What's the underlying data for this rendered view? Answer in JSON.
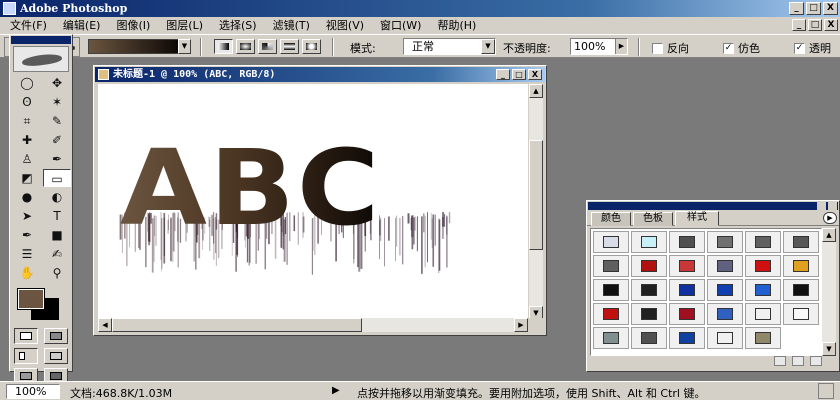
{
  "app": {
    "title": "Adobe Photoshop"
  },
  "window_controls": {
    "minimize": "_",
    "maximize": "□",
    "close": "X"
  },
  "menu": {
    "items": [
      "文件(F)",
      "编辑(E)",
      "图像(I)",
      "图层(L)",
      "选择(S)",
      "滤镜(T)",
      "视图(V)",
      "窗口(W)",
      "帮助(H)"
    ]
  },
  "options": {
    "mode_label": "模式:",
    "mode_value": "正常",
    "opacity_label": "不透明度:",
    "opacity_value": "100%",
    "reverse_label": "反向",
    "reverse_checked": false,
    "dither_label": "仿色",
    "dither_checked": true,
    "transparency_label": "透明",
    "transparency_checked": true,
    "gradient_colors": [
      "#6b5540",
      "#0d0805"
    ]
  },
  "toolbox": {
    "tools": [
      {
        "name": "marquee-tool",
        "glyph": "◯"
      },
      {
        "name": "move-tool",
        "glyph": "✥"
      },
      {
        "name": "lasso-tool",
        "glyph": "ʘ"
      },
      {
        "name": "magic-wand-tool",
        "glyph": "✶"
      },
      {
        "name": "crop-tool",
        "glyph": "⌗"
      },
      {
        "name": "slice-tool",
        "glyph": "✎"
      },
      {
        "name": "healing-brush-tool",
        "glyph": "✚"
      },
      {
        "name": "brush-tool",
        "glyph": "✐"
      },
      {
        "name": "clone-stamp-tool",
        "glyph": "♙"
      },
      {
        "name": "history-brush-tool",
        "glyph": "✒"
      },
      {
        "name": "eraser-tool",
        "glyph": "◩"
      },
      {
        "name": "gradient-tool",
        "glyph": "▭"
      },
      {
        "name": "blur-tool",
        "glyph": "●"
      },
      {
        "name": "dodge-tool",
        "glyph": "◐"
      },
      {
        "name": "path-selection-tool",
        "glyph": "➤"
      },
      {
        "name": "type-tool",
        "glyph": "T"
      },
      {
        "name": "pen-tool",
        "glyph": "✒"
      },
      {
        "name": "shape-tool",
        "glyph": "■"
      },
      {
        "name": "notes-tool",
        "glyph": "☰"
      },
      {
        "name": "eyedropper-tool",
        "glyph": "✍"
      },
      {
        "name": "hand-tool",
        "glyph": "✋"
      },
      {
        "name": "zoom-tool",
        "glyph": "⚲"
      }
    ],
    "selected_tool": "gradient-tool",
    "foreground_color": "#6b5540",
    "background_color": "#000000"
  },
  "document": {
    "title": "未标题-1 @ 100% (ABC, RGB/8)",
    "text": "ABC"
  },
  "styles_palette": {
    "tabs": [
      "颜色",
      "色板",
      "样式"
    ],
    "active_tab": "样式",
    "swatches": [
      "#d8dce8",
      "#c8f0f8",
      "#505050",
      "#707070",
      "#606060",
      "#585858",
      "#606060",
      "#b01010",
      "#c83838",
      "#606080",
      "#d01010",
      "#e0a020",
      "#101010",
      "#202020",
      "#1030a0",
      "#1040b0",
      "#2060d0",
      "#101010",
      "#c01010",
      "#202020",
      "#a01020",
      "#3060c0",
      "#f0f0f0",
      "#f8f8f8",
      "#809090",
      "#505050",
      "#1040a0",
      "#f0f0f0",
      "#908868"
    ]
  },
  "statusbar": {
    "zoom": "100%",
    "doc_info": "文档:468.8K/1.03M",
    "hint": "点按并拖移以用渐变填充。要用附加选项，使用 Shift、Alt 和 Ctrl 键。"
  }
}
